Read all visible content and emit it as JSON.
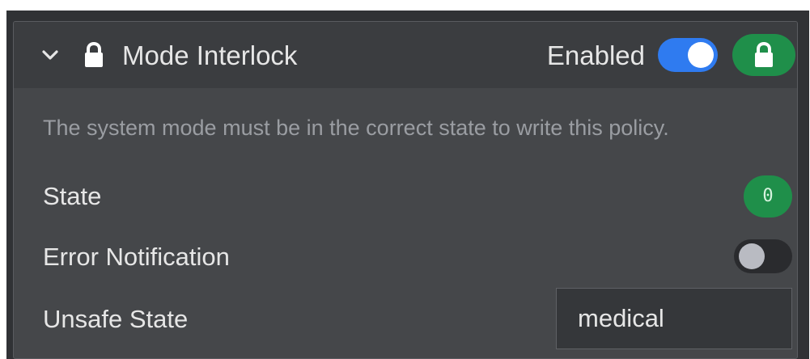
{
  "policy": {
    "title": "Mode Interlock",
    "enabled_label": "Enabled",
    "enabled": true,
    "description": "The system mode must be in the correct state to write this policy.",
    "header_icon": "lock-icon",
    "collapse_icon": "chevron-down-icon",
    "lock_badge_icon": "lock-icon"
  },
  "fields": {
    "state": {
      "label": "State",
      "value": "0"
    },
    "error_notification": {
      "label": "Error Notification",
      "enabled": false
    },
    "unsafe_state": {
      "label": "Unsafe State",
      "value": "medical"
    }
  },
  "colors": {
    "panel_background": "#45474a",
    "header_background": "#3b3d40",
    "toggle_on": "#2f7bf0",
    "success_badge": "#1f8f4a",
    "muted_text": "#9a9da2",
    "text": "#e6e6e6"
  }
}
